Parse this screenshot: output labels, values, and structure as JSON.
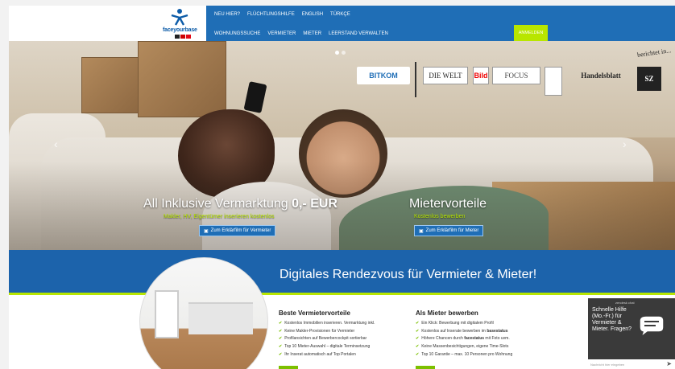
{
  "brand": {
    "logo_text": "faceyourbase"
  },
  "nav": {
    "top": [
      "NEU HIER?",
      "FLÜCHTLINGSHILFE",
      "ENGLISH",
      "TÜRKÇE"
    ],
    "bottom": [
      "WOHNUNGSSUCHE",
      "VERMIETER",
      "MIETER",
      "LEERSTAND VERWALTEN"
    ],
    "login": "ANMELDEN"
  },
  "press": {
    "berichtet": "berichtet in...",
    "bitkom": "BITKOM",
    "welt": "DIE WELT",
    "bild": "Bild",
    "focus": "FOCUS",
    "handelsblatt": "Handelsblatt",
    "sz": "SZ"
  },
  "hero": {
    "left_title_prefix": "All Inklusive Vermarktung ",
    "left_title_price": "0,- EUR",
    "left_sub": "Makler, HV, Eigentümer inserieren kostenlos",
    "left_btn": "Zum Erklärfilm für Vermieter",
    "right_title": "Mietervorteile",
    "right_sub": "Kostenlos bewerben",
    "right_btn": "Zum Erklärfilm für Mieter"
  },
  "banner": {
    "title": "Digitales Rendezvous für Vermieter & Mieter!"
  },
  "landlord": {
    "title": "Beste Vermietervorteile",
    "items": [
      "Kostenlos Immobilien inserieren. Vermarktung inkl.",
      "Keine Makler-Provisionen für Vermieter",
      "Profilansichten auf Bewerbercockpit sortierbar",
      "Top 10 Mieter-Auswahl – digitale Terminsetzung",
      "Ihr Inserat automatisch auf Top Portalen"
    ]
  },
  "tenant": {
    "title": "Als Mieter bewerben",
    "items": [
      {
        "text": "Ein Klick: Bewerbung mit digitalem Profil",
        "bold": ""
      },
      {
        "text": "Kostenlos auf Inserate bewerben im ",
        "bold": "basestatus"
      },
      {
        "text": "Höhere Chancen durch ",
        "bold": "facestatus",
        "suffix": " mit Foto uvm."
      },
      {
        "text": "Keine Massenbesichtigungen, eigene Time-Slots",
        "bold": ""
      },
      {
        "text": "Top 10 Garantie – max. 10 Personen pro Wohnung",
        "bold": ""
      }
    ]
  },
  "help": {
    "top": "zendesk chat",
    "text": "Schnelle Hilfe (Mo.-Fr.) für Vermieter & Mieter. Fragen?",
    "input_placeholder": "Nachricht hier eingeben"
  },
  "colors": {
    "brand_blue": "#1f6eb6",
    "accent_green": "#b8e600",
    "banner_blue": "#1c63ab"
  }
}
